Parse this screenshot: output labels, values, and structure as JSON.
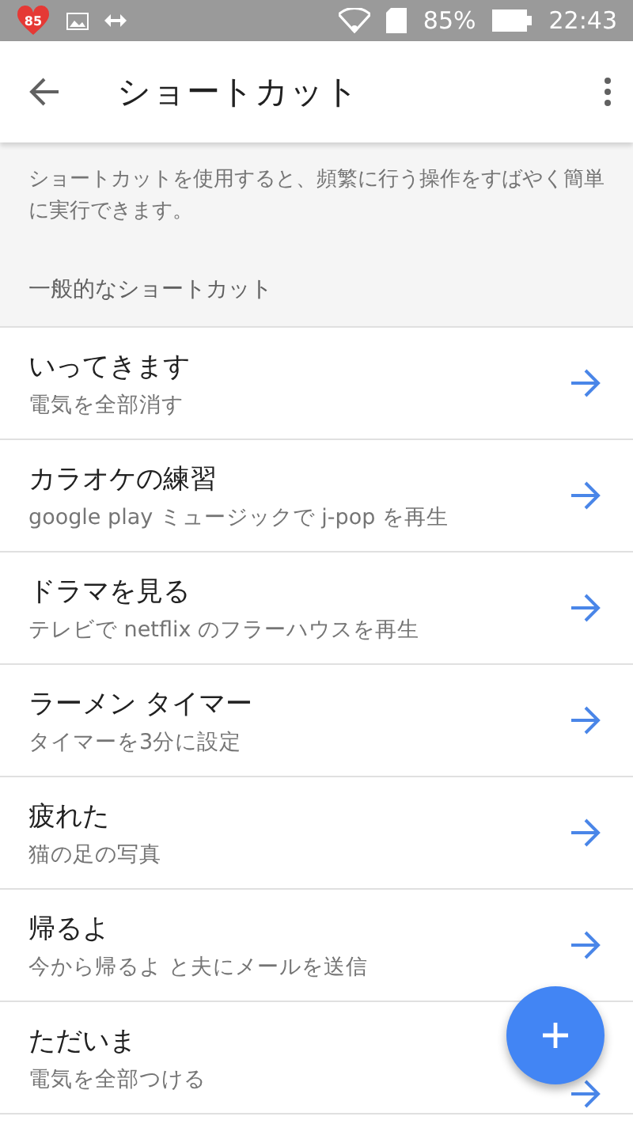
{
  "status_bar": {
    "badge": "85",
    "battery": "85%",
    "time": "22:43"
  },
  "app_bar": {
    "title": "ショートカット"
  },
  "description": "ショートカットを使用すると、頻繁に行う操作をすばやく簡単に実行できます。",
  "section_header": "一般的なショートカット",
  "shortcuts": [
    {
      "title": "いってきます",
      "subtitle": "電気を全部消す"
    },
    {
      "title": "カラオケの練習",
      "subtitle": "google play ミュージックで j-pop を再生"
    },
    {
      "title": "ドラマを見る",
      "subtitle": "テレビで netflix のフラーハウスを再生"
    },
    {
      "title": "ラーメン タイマー",
      "subtitle": "タイマーを3分に設定"
    },
    {
      "title": "疲れた",
      "subtitle": "猫の足の写真"
    },
    {
      "title": "帰るよ",
      "subtitle": "今から帰るよ と夫にメールを送信"
    },
    {
      "title": "ただいま",
      "subtitle": "電気を全部つける"
    }
  ]
}
